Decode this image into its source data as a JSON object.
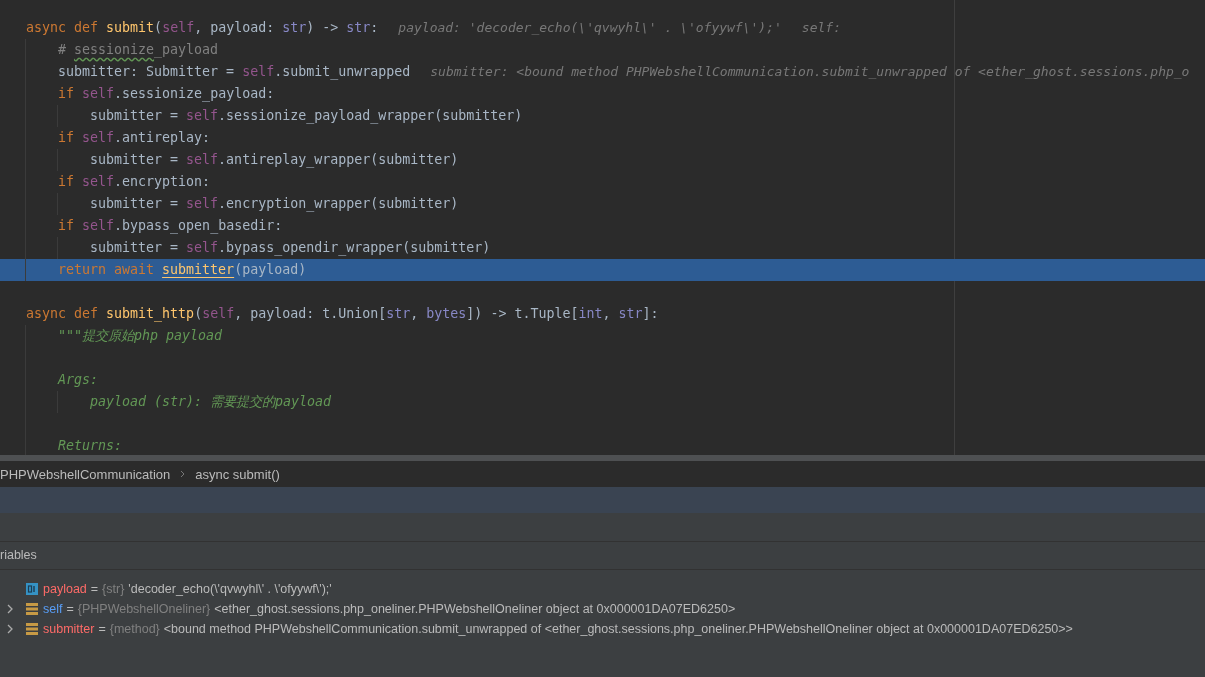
{
  "editor": {
    "lines": [
      {
        "selected": false,
        "tokens": [
          {
            "kind": "kw",
            "text": "async def "
          },
          {
            "kind": "fn",
            "text": "submit"
          },
          {
            "kind": "plain",
            "text": "("
          },
          {
            "kind": "self",
            "text": "self"
          },
          {
            "kind": "plain",
            "text": ", payload: "
          },
          {
            "kind": "type",
            "text": "str"
          },
          {
            "kind": "plain",
            "text": ") -> "
          },
          {
            "kind": "type",
            "text": "str"
          },
          {
            "kind": "plain",
            "text": ":"
          }
        ],
        "hints": [
          "payload: 'decoder_echo(\\'qvwyhl\\' . \\'ofyywf\\');'",
          "self:"
        ],
        "children": [
          {
            "selected": false,
            "tokens": [
              {
                "kind": "comment",
                "text": "# "
              },
              {
                "kind": "typo",
                "text": "sessionize"
              },
              {
                "kind": "comment",
                "text": "_payload"
              }
            ]
          },
          {
            "selected": false,
            "tokens": [
              {
                "kind": "plain",
                "text": "submitter: Submitter = "
              },
              {
                "kind": "self",
                "text": "self"
              },
              {
                "kind": "plain",
                "text": ".submit_unwrapped"
              }
            ],
            "hints": [
              "submitter: <bound method PHPWebshellCommunication.submit_unwrapped of <ether_ghost.sessions.php_o"
            ]
          },
          {
            "selected": false,
            "tokens": [
              {
                "kind": "kw",
                "text": "if "
              },
              {
                "kind": "self",
                "text": "self"
              },
              {
                "kind": "plain",
                "text": ".sessionize_payload:"
              }
            ],
            "children": [
              {
                "selected": false,
                "tokens": [
                  {
                    "kind": "plain",
                    "text": "submitter = "
                  },
                  {
                    "kind": "self",
                    "text": "self"
                  },
                  {
                    "kind": "plain",
                    "text": ".sessionize_payload_wrapper(submitter)"
                  }
                ]
              }
            ]
          },
          {
            "selected": false,
            "tokens": [
              {
                "kind": "kw",
                "text": "if "
              },
              {
                "kind": "self",
                "text": "self"
              },
              {
                "kind": "plain",
                "text": ".antireplay:"
              }
            ],
            "children": [
              {
                "selected": false,
                "tokens": [
                  {
                    "kind": "plain",
                    "text": "submitter = "
                  },
                  {
                    "kind": "self",
                    "text": "self"
                  },
                  {
                    "kind": "plain",
                    "text": ".antireplay_wrapper(submitter)"
                  }
                ]
              }
            ]
          },
          {
            "selected": false,
            "tokens": [
              {
                "kind": "kw",
                "text": "if "
              },
              {
                "kind": "self",
                "text": "self"
              },
              {
                "kind": "plain",
                "text": ".encryption:"
              }
            ],
            "children": [
              {
                "selected": false,
                "tokens": [
                  {
                    "kind": "plain",
                    "text": "submitter = "
                  },
                  {
                    "kind": "self",
                    "text": "self"
                  },
                  {
                    "kind": "plain",
                    "text": ".encryption_wrapper(submitter)"
                  }
                ]
              }
            ]
          },
          {
            "selected": false,
            "tokens": [
              {
                "kind": "kw",
                "text": "if "
              },
              {
                "kind": "self",
                "text": "self"
              },
              {
                "kind": "plain",
                "text": ".bypass_open_basedir:"
              }
            ],
            "children": [
              {
                "selected": false,
                "tokens": [
                  {
                    "kind": "plain",
                    "text": "submitter = "
                  },
                  {
                    "kind": "self",
                    "text": "self"
                  },
                  {
                    "kind": "plain",
                    "text": ".bypass_opendir_wrapper(submitter)"
                  }
                ]
              }
            ]
          },
          {
            "selected": true,
            "tokens": [
              {
                "kind": "kw",
                "text": "return await "
              },
              {
                "kind": "ref",
                "text": "submitter"
              },
              {
                "kind": "plain",
                "text": "(payload)"
              }
            ]
          }
        ]
      },
      {
        "selected": false
      },
      {
        "selected": false,
        "tokens": [
          {
            "kind": "kw",
            "text": "async def "
          },
          {
            "kind": "fn",
            "text": "submit_http"
          },
          {
            "kind": "plain",
            "text": "("
          },
          {
            "kind": "self",
            "text": "self"
          },
          {
            "kind": "plain",
            "text": ", payload: t.Union["
          },
          {
            "kind": "type",
            "text": "str"
          },
          {
            "kind": "plain",
            "text": ", "
          },
          {
            "kind": "type",
            "text": "bytes"
          },
          {
            "kind": "plain",
            "text": "]) -> t.Tuple["
          },
          {
            "kind": "type",
            "text": "int"
          },
          {
            "kind": "plain",
            "text": ", "
          },
          {
            "kind": "type",
            "text": "str"
          },
          {
            "kind": "plain",
            "text": "]:"
          }
        ],
        "children": [
          {
            "selected": false,
            "tokens": [
              {
                "kind": "doc",
                "text": "\"\"\"提交原始php payload"
              }
            ]
          },
          {
            "selected": false
          },
          {
            "selected": false,
            "tokens": [
              {
                "kind": "doc",
                "text": "Args:"
              }
            ],
            "children": [
              {
                "selected": false,
                "tokens": [
                  {
                    "kind": "doc",
                    "text": "payload (str): 需要提交的payload"
                  }
                ]
              }
            ]
          },
          {
            "selected": false
          },
          {
            "selected": false,
            "tokens": [
              {
                "kind": "doc",
                "text": "Returns:"
              }
            ]
          }
        ]
      }
    ]
  },
  "breadcrumb": [
    "PHPWebshellCommunication",
    "async submit()"
  ],
  "variables": {
    "title": "riables",
    "items": [
      {
        "kind": "primitive",
        "name": "payload",
        "color": "#ff6b68",
        "sign": "=",
        "type": "{str}",
        "value": "'decoder_echo(\\'qvwyhl\\' . \\'ofyywf\\');'"
      },
      {
        "kind": "object",
        "name": "self",
        "color": "#589df6",
        "sign": "=",
        "type": "{PHPWebshellOneliner}",
        "value": "<ether_ghost.sessions.php_oneliner.PHPWebshellOneliner object at 0x000001DA07ED6250>"
      },
      {
        "kind": "object",
        "name": "submitter",
        "color": "#ff6b68",
        "sign": "=",
        "type": "{method}",
        "value": "<bound method PHPWebshellCommunication.submit_unwrapped of <ether_ghost.sessions.php_oneliner.PHPWebshellOneliner object at 0x000001DA07ED6250>>"
      }
    ]
  }
}
